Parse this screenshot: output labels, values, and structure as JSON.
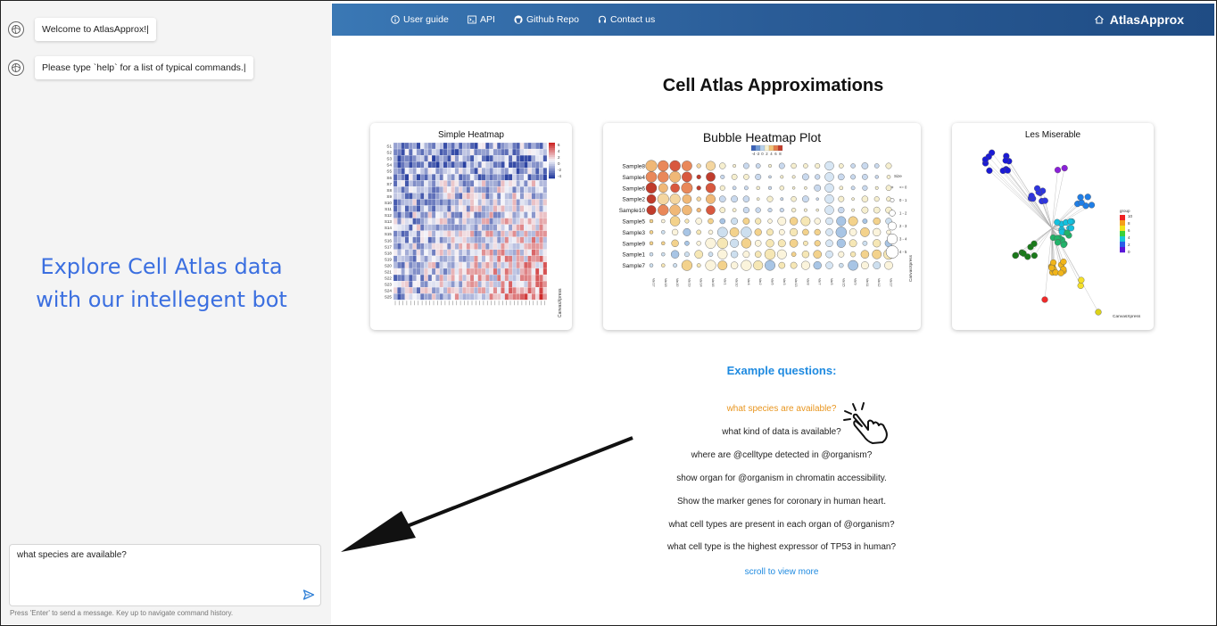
{
  "chat": {
    "messages": [
      {
        "text": "Welcome to AtlasApprox!|"
      },
      {
        "text": "Please type `help` for a list of typical commands.|"
      }
    ],
    "tagline_line1": "Explore Cell Atlas data",
    "tagline_line2": "with our intellegent bot",
    "input_value": "what species are available?",
    "hint": "Press 'Enter' to send a message. Key up to navigate command history."
  },
  "nav": {
    "items": [
      {
        "label": "User guide",
        "icon": "info-icon"
      },
      {
        "label": "API",
        "icon": "terminal-icon"
      },
      {
        "label": "Github Repo",
        "icon": "github-icon"
      },
      {
        "label": "Contact us",
        "icon": "headset-icon"
      }
    ],
    "brand": "AtlasApprox",
    "brand_icon": "home-icon",
    "gradient": [
      "#3a78b5",
      "#1f4c84"
    ]
  },
  "main": {
    "title": "Cell Atlas Approximations",
    "cards": [
      {
        "title": "Simple Heatmap",
        "watermark": "CanvasXpress"
      },
      {
        "title": "Bubble Heatmap Plot",
        "watermark": "CanvasXpress"
      },
      {
        "title": "Les Miserable",
        "watermark": "CanvasXpress"
      }
    ],
    "examples_title": "Example questions:",
    "questions": [
      "what species are available?",
      "what kind of data is available?",
      "where are @celltype detected in @organism?",
      "show organ for @organism in chromatin accessibility.",
      "Show the marker genes for coronary in human heart.",
      "what cell types are present in each organ of @organism?",
      "what cell type is the highest expressor of TP53 in human?"
    ],
    "scroll_more": "scroll to view more"
  },
  "chart_data": [
    {
      "type": "heatmap",
      "title": "Simple Heatmap",
      "rows": [
        "S1",
        "S2",
        "S3",
        "S4",
        "S5",
        "S6",
        "S7",
        "S8",
        "S9",
        "S10",
        "S11",
        "S12",
        "S13",
        "S14",
        "S15",
        "S16",
        "S17",
        "S18",
        "S19",
        "S20",
        "S21",
        "S22",
        "S23",
        "S24",
        "S25"
      ],
      "legend_ticks": [
        "6",
        "4",
        "2",
        "0",
        "-2",
        "-4"
      ]
    },
    {
      "type": "scatter",
      "subtype": "bubble-heatmap",
      "title": "Bubble Heatmap Plot",
      "rows": [
        "Sample8",
        "Sample4",
        "Sample6",
        "Sample2",
        "Sample10",
        "Sample5",
        "Sample3",
        "Sample9",
        "Sample1",
        "Sample7"
      ],
      "columns": [
        "Var17",
        "Var18",
        "Var20",
        "Var19",
        "Var14",
        "Var16",
        "Var1",
        "Var10",
        "Var4",
        "Var2",
        "Var6",
        "Var3",
        "Var13",
        "Var8",
        "Var7",
        "Var5",
        "Var15",
        "Var9",
        "Var11",
        "Var12",
        "Var17"
      ],
      "color_legend_ticks": [
        "-4",
        "-2",
        "0",
        "2",
        "4",
        "6",
        "8"
      ],
      "size_legend_title": "Size",
      "size_legend": [
        "<= 0",
        "0 - 1",
        "1 - 2",
        "2 - 3",
        "3 - 4",
        "4 - 5"
      ]
    },
    {
      "type": "scatter",
      "subtype": "network",
      "title": "Les Miserable",
      "legend_title": "group",
      "legend_ticks": [
        "10",
        "8",
        "6",
        "4",
        "2",
        "0"
      ]
    }
  ]
}
